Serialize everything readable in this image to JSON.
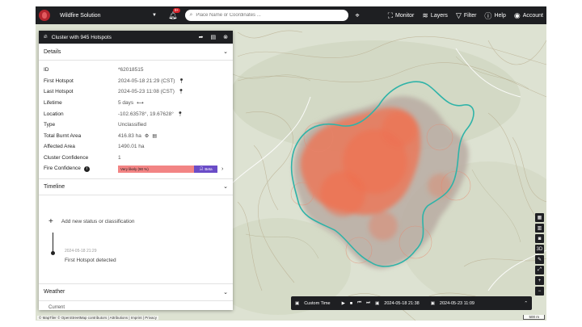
{
  "topbar": {
    "app_name": "Wildfire Solution",
    "notification_count": "9+",
    "search_placeholder": "Place Name or Coordinates ...",
    "nav": [
      {
        "label": "Monitor",
        "icon": "monitor-icon"
      },
      {
        "label": "Layers",
        "icon": "layers-icon"
      },
      {
        "label": "Filter",
        "icon": "filter-icon"
      },
      {
        "label": "Help",
        "icon": "help-icon"
      },
      {
        "label": "Account",
        "icon": "account-icon"
      }
    ]
  },
  "panel": {
    "title": "Cluster with 945 Hotspots",
    "details_label": "Details",
    "fields": {
      "id": {
        "label": "ID",
        "value": "*62018515"
      },
      "first_hotspot": {
        "label": "First Hotspot",
        "value": "2024-05-18 21:29 (CST)"
      },
      "last_hotspot": {
        "label": "Last Hotspot",
        "value": "2024-05-23 11:08 (CST)"
      },
      "lifetime": {
        "label": "Lifetime",
        "value": "5 days"
      },
      "location": {
        "label": "Location",
        "value": "-102.63578°, 19.67628°"
      },
      "type": {
        "label": "Type",
        "value": "Unclassified"
      },
      "total_burnt_area": {
        "label": "Total Burnt Area",
        "value": "416.83 ha"
      },
      "affected_area": {
        "label": "Affected Area",
        "value": "1490.01 ha"
      },
      "cluster_confidence": {
        "label": "Cluster Confidence",
        "value": "1"
      },
      "fire_confidence": {
        "label": "Fire Confidence",
        "value": "Very likely (90 %)",
        "beta": "Beta"
      }
    },
    "timeline_label": "Timeline",
    "add_status": "Add new status or classification",
    "event": {
      "date": "2024-05-18 21:29",
      "text": "First Hotspot detected"
    },
    "weather_label": "Weather",
    "current_label": "Current"
  },
  "map": {
    "attribution": "© MapTiler © OpenStreetMap contributors | Attributions | Imprint | Privacy",
    "scale": "500 m",
    "controls": [
      "map-icon",
      "book-icon",
      "camera-icon",
      "3D",
      "ruler-icon",
      "expand-icon",
      "+",
      "−"
    ]
  },
  "timebar": {
    "label": "Custom Time",
    "start": "2024-05-18 21:38",
    "end": "2024-05-23 11:09"
  },
  "colors": {
    "dark": "#1e1f22",
    "hotspot": "#f0704f",
    "perimeter": "#2fb3a8",
    "beta": "#6a4cc7",
    "confidence": "#f28484"
  }
}
